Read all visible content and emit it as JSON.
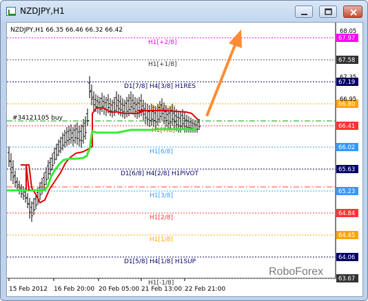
{
  "window": {
    "title": "NZDJPY,H1",
    "buttons": {
      "minimize": "minimize",
      "maximize": "maximize",
      "close": "close"
    }
  },
  "chart": {
    "header": "NZDJPY,H1  66.35 66.46 66.32 66.42",
    "watermark": "RoboForex",
    "order_label": "#34121105 buy",
    "murrey_labels": {
      "h1_p2_8": "H1[+2/8]",
      "h1_p1_8": "H1[+1/8]",
      "res": "D1[7/8] H4[3/8] H1RES",
      "h1_6_8": "H1[6/8]",
      "pivot": "D1[6/8] H4[2/8] H1PIVOT",
      "h1_3_8": "H1[3/8]",
      "h1_2_8": "H1[2/8]",
      "h1_1_8": "H1[1/8]",
      "sup": "D1[5/8] H4[1/8] H1SUP",
      "bottom_partial": "H1[-1/8]",
      "h1_8_8": "H1[8/8]",
      "h1_7_8": "H1[7/8]"
    },
    "price_tags": [
      {
        "text": "67.97",
        "color": "#ff00ff"
      },
      {
        "text": "67.58",
        "color": "#333333"
      },
      {
        "text": "67.19",
        "color": "#000066"
      },
      {
        "text": "66.80",
        "color": "#ffa500"
      },
      {
        "text": "66.41",
        "color": "#ff3333"
      },
      {
        "text": "66.02",
        "color": "#3399ff"
      },
      {
        "text": "65.63",
        "color": "#000066"
      },
      {
        "text": "65.23",
        "color": "#3399ff"
      },
      {
        "text": "64.84",
        "color": "#ff3333"
      },
      {
        "text": "64.45",
        "color": "#ffa500"
      },
      {
        "text": "64.06",
        "color": "#000066"
      },
      {
        "text": "63.67",
        "color": "#333333"
      }
    ],
    "axis_ticks_partial": [
      "68.05",
      "67.35",
      "66.95"
    ],
    "x_ticks": [
      "15 Feb 2012",
      "16 Feb 20:00",
      "20 Feb 05:00",
      "21 Feb 13:00",
      "22 Feb 21:00"
    ],
    "colors": {
      "supertrend_green": "#33ee33",
      "supertrend_red": "#dd0000",
      "arrow": "#ff8c33",
      "order_line": "#009900"
    }
  }
}
